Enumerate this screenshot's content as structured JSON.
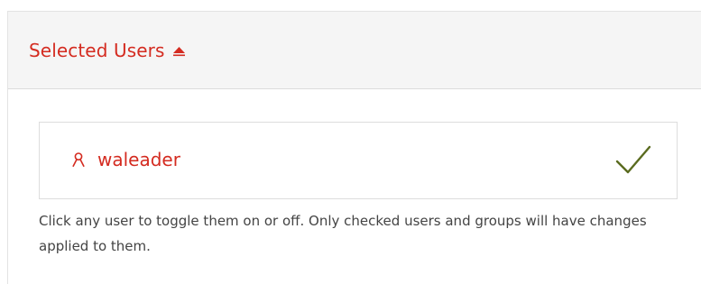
{
  "panel": {
    "title": "Selected Users",
    "collapse_icon": "caret-up-icon",
    "accent_color": "#d42b20"
  },
  "users": [
    {
      "name": "waleader",
      "icon": "user-icon",
      "checked": true,
      "check_icon": "checkmark-icon",
      "check_color": "#5a6b1f"
    }
  ],
  "help_text": "Click any user to toggle them on or off. Only checked users and groups will have changes applied to them."
}
